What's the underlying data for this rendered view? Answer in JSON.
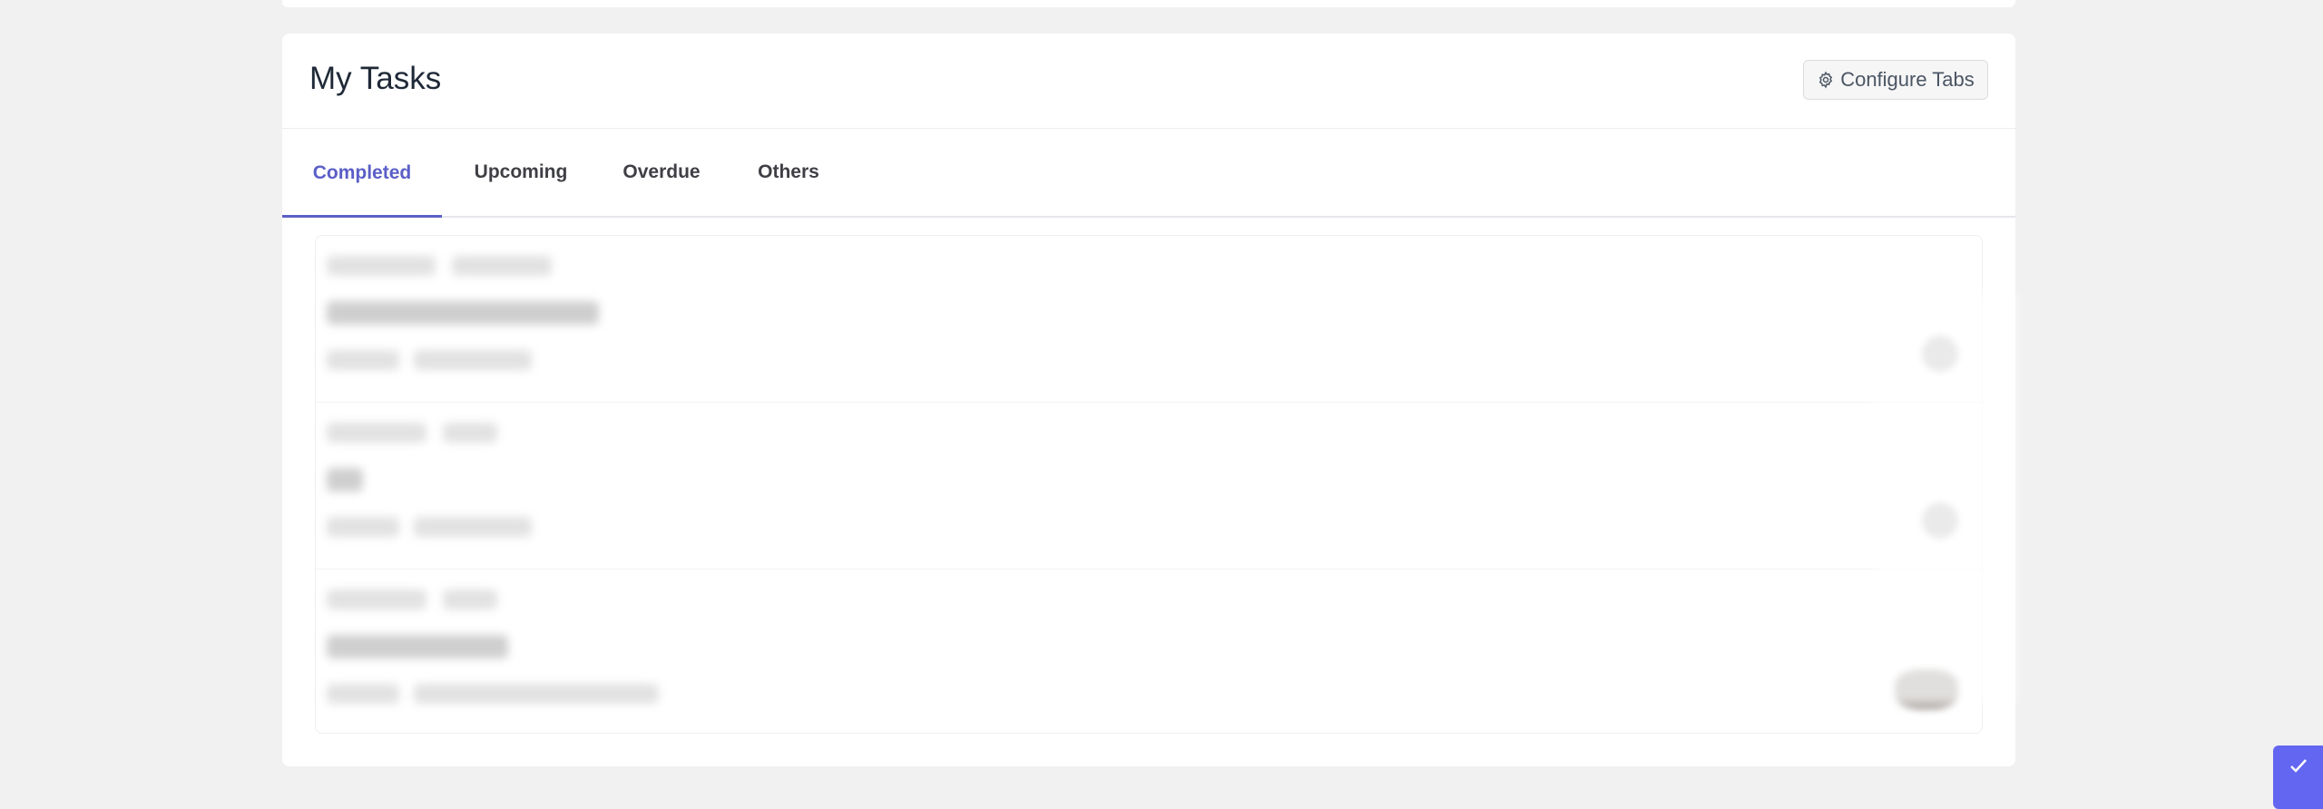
{
  "header": {
    "title": "My Tasks",
    "configure_label": "Configure Tabs"
  },
  "tabs": [
    {
      "label": "Completed",
      "active": true
    },
    {
      "label": "Upcoming",
      "active": false
    },
    {
      "label": "Overdue",
      "active": false
    },
    {
      "label": "Others",
      "active": false
    }
  ],
  "colors": {
    "accent": "#5b5fc7",
    "page_bg": "#f1f1f1",
    "card_bg": "#ffffff",
    "fab": "#6366f1"
  },
  "icons": {
    "configure": "gear-icon",
    "fab": "check-icon"
  }
}
